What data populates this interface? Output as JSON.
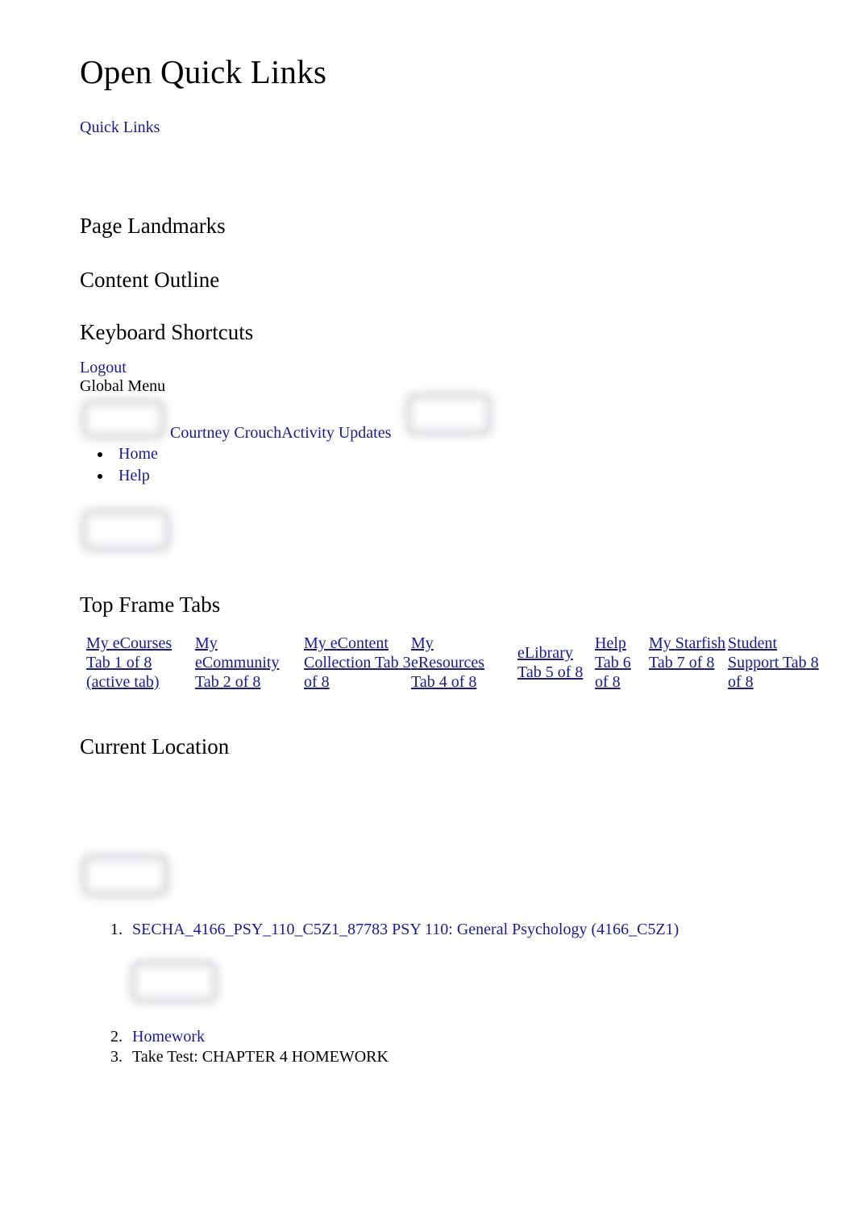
{
  "page": {
    "title": "Open Quick Links",
    "background_color": "#ffffff",
    "link_color": "#1b1b8f",
    "text_color": "#000000"
  },
  "quick_links": {
    "label": "Quick Links"
  },
  "sections": {
    "page_landmarks": "Page Landmarks",
    "content_outline": "Content Outline",
    "keyboard_shortcuts": "Keyboard Shortcuts",
    "top_frame_tabs": "Top Frame Tabs",
    "current_location": "Current Location"
  },
  "global": {
    "logout": "Logout",
    "global_menu": "Global Menu",
    "user_activity": "Courtney CrouchActivity Updates",
    "menu_items": [
      {
        "label": "Home"
      },
      {
        "label": "Help"
      }
    ]
  },
  "tabs": [
    {
      "label": "My eCourses",
      "position": "Tab 1 of",
      "position2": "8 (active tab)",
      "active": true
    },
    {
      "label": "My",
      "position": "eCommunity",
      "position2": "Tab 2 of 8",
      "active": false
    },
    {
      "label": "My eContent",
      "position": "Collection Tab",
      "position2": "3 of 8",
      "active": false
    },
    {
      "label": "My",
      "position": "eResources",
      "position2": "Tab 4 of 8",
      "active": false
    },
    {
      "label": "eLibrary",
      "position": "Tab 5 of 8",
      "position2": "",
      "active": false
    },
    {
      "label": "Help",
      "position": "Tab 6",
      "position2": "of 8",
      "active": false
    },
    {
      "label": "My",
      "position": "Starfish",
      "position2": "Tab 7 of 8",
      "active": false
    },
    {
      "label": "Student",
      "position": "Support Tab",
      "position2": "8 of 8",
      "active": false
    }
  ],
  "breadcrumbs": [
    {
      "number": "1.",
      "label": "SECHA_4166_PSY_110_C5Z1_87783 PSY 110: General Psychology (4166_C5Z1)",
      "is_link": true
    },
    {
      "number": "2.",
      "label": "Homework",
      "is_link": true
    },
    {
      "number": "3.",
      "label": "Take Test: CHAPTER 4 HOMEWORK",
      "is_link": false
    }
  ],
  "placeholders": [
    {
      "name": "broken-image-global-menu"
    },
    {
      "name": "broken-image-activity-updates"
    },
    {
      "name": "broken-image-below-menu"
    },
    {
      "name": "broken-image-current-location"
    },
    {
      "name": "broken-image-course-path"
    }
  ]
}
